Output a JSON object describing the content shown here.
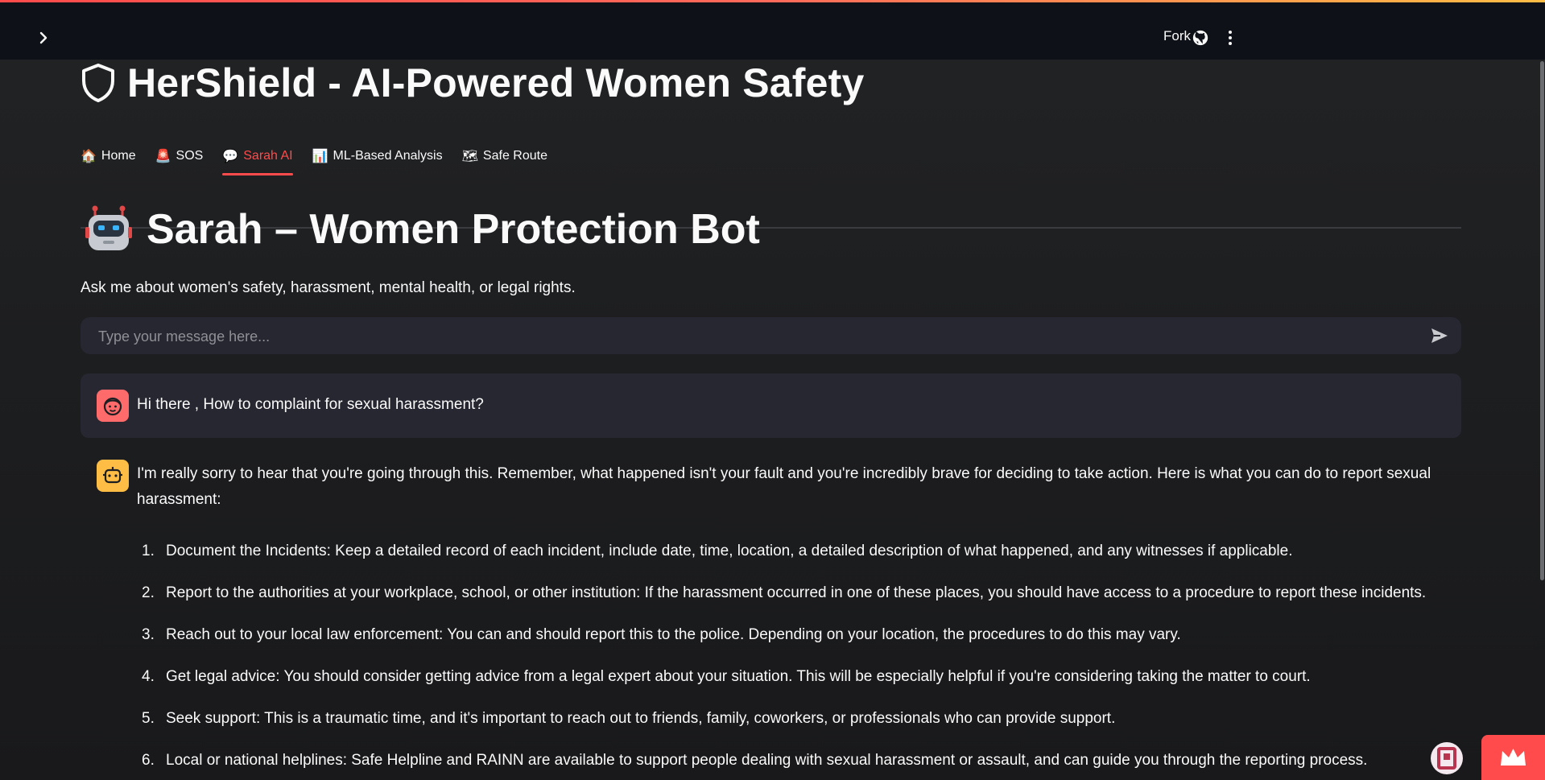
{
  "topbar": {
    "fork_label": "Fork",
    "icons": [
      "chevron-right-icon",
      "github-icon",
      "more-vert-icon"
    ]
  },
  "app": {
    "title": "HerShield - AI-Powered Women Safety",
    "title_icon": "shield-icon",
    "accent_color": "#ff4b4b"
  },
  "tabs": [
    {
      "icon": "🏠",
      "label": "Home",
      "active": false
    },
    {
      "icon": "🚨",
      "label": "SOS",
      "active": false
    },
    {
      "icon": "💬",
      "label": "Sarah AI",
      "active": true
    },
    {
      "icon": "📊",
      "label": "ML-Based Analysis",
      "active": false
    },
    {
      "icon": "🗺",
      "label": "Safe Route",
      "active": false
    }
  ],
  "page": {
    "title": "Sarah – Women Protection Bot",
    "title_icon": "robot-icon",
    "subtitle": "Ask me about women's safety, harassment, mental health, or legal rights."
  },
  "chat_input": {
    "placeholder": "Type your message here..."
  },
  "messages": {
    "user": {
      "text": "Hi there , How to complaint for sexual harassment?",
      "avatar_color": "#ff6b6b"
    },
    "bot": {
      "avatar_color": "#ffbd45",
      "intro": "I'm really sorry to hear that you're going through this. Remember, what happened isn't your fault and you're incredibly brave for deciding to take action. Here is what you can do to report sexual harassment:",
      "steps": [
        {
          "num": "1.",
          "text": "Document the Incidents: Keep a detailed record of each incident, include date, time, location, a detailed description of what happened, and any witnesses if applicable."
        },
        {
          "num": "2.",
          "text": "Report to the authorities at your workplace, school, or other institution: If the harassment occurred in one of these places, you should have access to a procedure to report these incidents."
        },
        {
          "num": "3.",
          "text": "Reach out to your local law enforcement: You can and should report this to the police. Depending on your location, the procedures to do this may vary."
        },
        {
          "num": "4.",
          "text": "Get legal advice: You should consider getting advice from a legal expert about your situation. This will be especially helpful if you're considering taking the matter to court."
        },
        {
          "num": "5.",
          "text": "Seek support: This is a traumatic time, and it's important to reach out to friends, family, coworkers, or professionals who can provide support."
        },
        {
          "num": "6.",
          "text": "Local or national helplines: Safe Helpline and RAINN are available to support people dealing with sexual harassment or assault, and can guide you through the reporting process."
        }
      ]
    }
  }
}
